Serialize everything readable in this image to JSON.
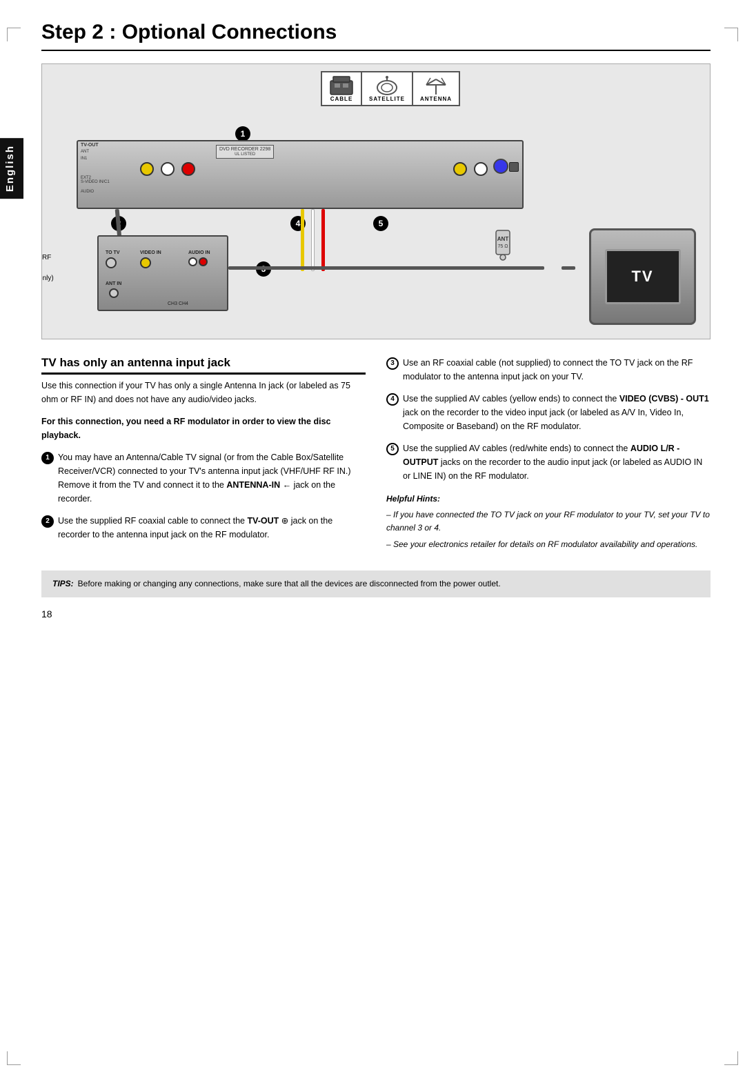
{
  "page": {
    "title": "Step 2 : Optional Connections",
    "number": "18",
    "tab_label": "English"
  },
  "diagram": {
    "input_sources": [
      {
        "id": "cable",
        "label": "CABLE",
        "icon": "📺"
      },
      {
        "id": "satellite",
        "label": "SATELLITE",
        "icon": "📡"
      },
      {
        "id": "antenna",
        "label": "ANTENNA",
        "icon": "📶"
      }
    ],
    "step_numbers": [
      "1",
      "2",
      "3",
      "4",
      "5"
    ],
    "rf_modulator_label": "Back of an RF\nModulator\n(Example only)",
    "rf_modulator_sublabels": [
      "ANT IN",
      "VIDEO IN",
      "AUDIO IN",
      "TO TV",
      "CH3",
      "CH4"
    ],
    "tv_label": "TV",
    "ant_label": "ANT\n75 Ω ™"
  },
  "section": {
    "title": "TV has only an antenna input jack",
    "intro": "Use this connection if your TV has only a single Antenna In jack (or labeled as 75 ohm or RF IN) and does not have any audio/video jacks.",
    "warning": "For this connection, you need a RF modulator in order to view the disc playback.",
    "steps_left": [
      {
        "num": "1",
        "style": "filled",
        "text": "You may have an Antenna/Cable TV signal (or from the Cable Box/Satellite Receiver/VCR) connected to your TV's antenna input jack (VHF/UHF RF IN.) Remove it from the TV and connect it to the ",
        "bold_part": "ANTENNA-IN",
        "icon_part": " ← jack on the recorder."
      },
      {
        "num": "2",
        "style": "filled",
        "text": "Use the supplied RF coaxial cable to connect the ",
        "bold_part": "TV-OUT",
        "icon_part": " ⊕ jack on the recorder to the antenna input jack on the RF modulator."
      }
    ],
    "steps_right": [
      {
        "num": "3",
        "style": "outline",
        "text": "Use an RF coaxial cable (not supplied) to connect the TO TV jack on the RF modulator to the antenna input jack on your TV."
      },
      {
        "num": "4",
        "style": "outline",
        "text": "Use the supplied AV cables (yellow ends) to connect the ",
        "bold1": "VIDEO (CVBS) -",
        "text2": " OUT1 jack on the recorder to the video input jack (or labeled as A/V In, Video In, Composite or Baseband) on the RF modulator.",
        "bold1_is_bold": true,
        "out1_bold": true
      },
      {
        "num": "5",
        "style": "outline",
        "text": "Use the supplied AV cables (red/white ends) to connect the ",
        "bold1": "AUDIO L/R -",
        "text2": " OUTPUT jacks on the recorder to the audio input jack (or labeled as AUDIO IN or LINE IN) on the RF modulator.",
        "bold1_is_bold": true,
        "output_bold": true
      }
    ],
    "helpful_hints_title": "Helpful Hints:",
    "helpful_hints": [
      "– If you have connected the TO TV jack on your RF modulator to your TV, set your TV to channel 3 or 4.",
      "– See your electronics retailer for details on RF modulator availability and operations."
    ]
  },
  "tips": {
    "label": "TIPS:",
    "text": "Before making or changing any connections, make sure that all the devices are disconnected from the power outlet."
  }
}
